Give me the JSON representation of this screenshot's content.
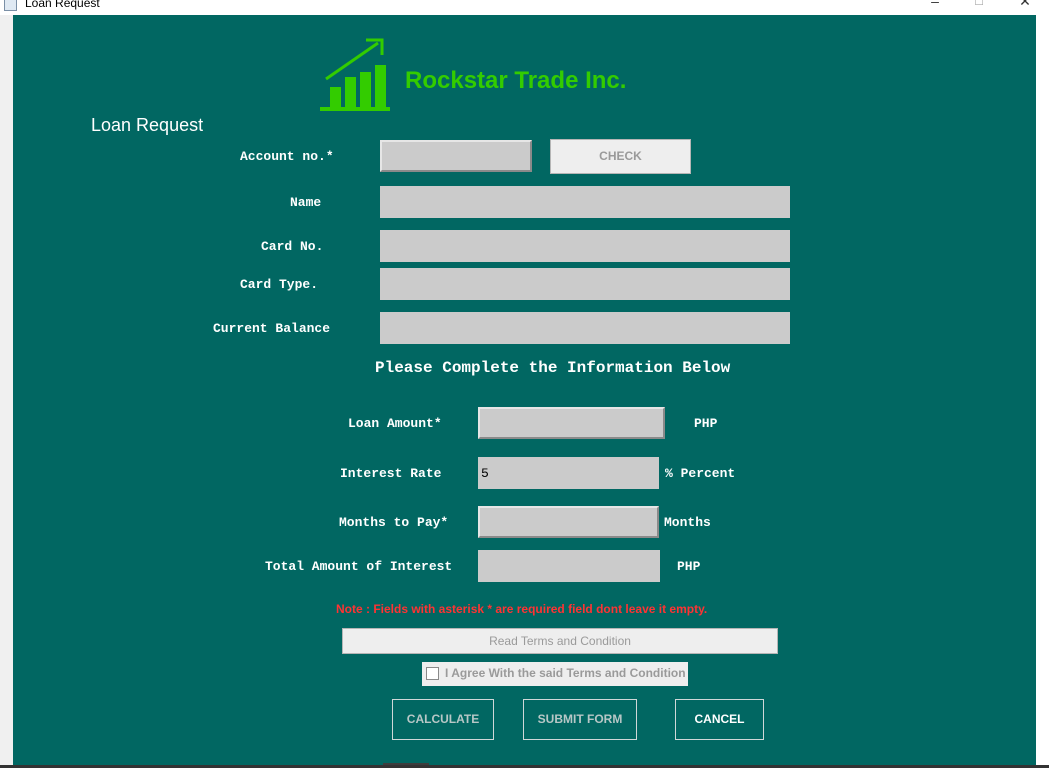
{
  "window": {
    "title": "Loan Request",
    "min_glyph": "–",
    "max_glyph": "☐",
    "close_glyph": "✕"
  },
  "brand": {
    "name": "Rockstar Trade Inc.",
    "color": "#33cc00"
  },
  "form": {
    "heading": "Loan Request",
    "account_label": "Account no.*",
    "account_value": "",
    "check_label": "CHECK",
    "name_label": "Name",
    "name_value": "",
    "card_no_label": "Card No.",
    "card_no_value": "",
    "card_type_label": "Card Type.",
    "card_type_value": "",
    "balance_label": "Current Balance",
    "balance_value": "",
    "section_heading": "Please Complete the Information Below",
    "loan_amount_label": "Loan Amount*",
    "loan_amount_value": "",
    "loan_amount_unit": "PHP",
    "interest_rate_label": "Interest Rate",
    "interest_rate_value": "5",
    "interest_rate_unit": "% Percent",
    "months_label": "Months to Pay*",
    "months_value": "",
    "months_unit": "Months",
    "total_interest_label": "Total Amount of Interest",
    "total_interest_value": "",
    "total_interest_unit": "PHP",
    "note": "Note : Fields with asterisk * are required field dont leave it empty.",
    "terms_button": "Read Terms and Condition",
    "agree_label": "I Agree With the said Terms and Condition",
    "agree_checked": false
  },
  "actions": {
    "calculate": "CALCULATE",
    "submit": "SUBMIT FORM",
    "cancel": "CANCEL"
  },
  "colors": {
    "panel_bg": "#016762",
    "field_bg": "#cbcbcb",
    "note_red": "#ff3333"
  }
}
